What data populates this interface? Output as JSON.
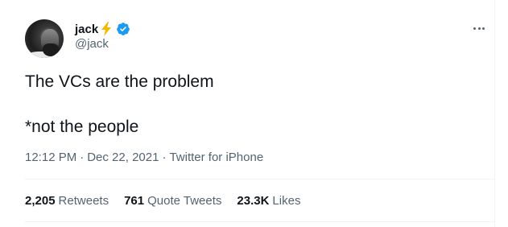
{
  "user": {
    "display_name": "jack",
    "handle": "@jack"
  },
  "tweet": {
    "text": "The VCs are the problem\n\n*not the people",
    "time": "12:12 PM",
    "date": "Dec 22, 2021",
    "source": "Twitter for iPhone"
  },
  "stats": {
    "retweets_count": "2,205",
    "retweets_label": "Retweets",
    "quote_tweets_count": "761",
    "quote_tweets_label": "Quote Tweets",
    "likes_count": "23.3K",
    "likes_label": "Likes"
  },
  "colors": {
    "text_primary": "#0f1419",
    "text_secondary": "#536471",
    "verified_blue": "#1d9bf0",
    "bolt_yellow": "#f5b800",
    "divider": "#eff3f4"
  },
  "icons": {
    "verified": "verified-badge-icon",
    "bolt": "lightning-bolt-icon",
    "more": "more-options-icon"
  }
}
